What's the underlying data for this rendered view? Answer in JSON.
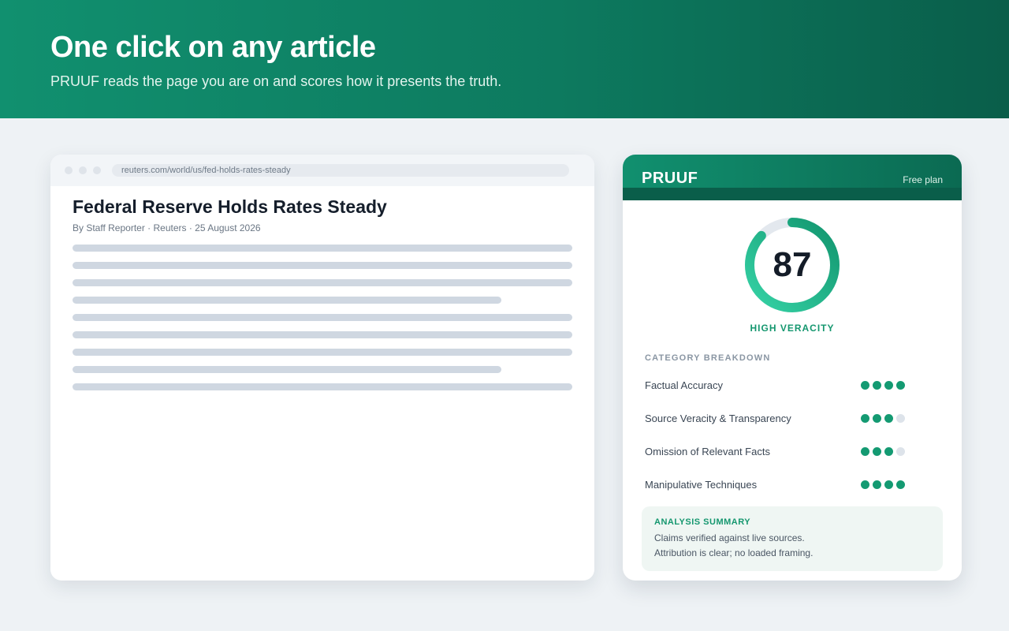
{
  "hero": {
    "title": "One click on any article",
    "subtitle": "PRUUF reads the page you are on and scores how it presents the truth."
  },
  "browser": {
    "url": "reuters.com/world/us/fed-holds-rates-steady",
    "article": {
      "headline": "Federal Reserve Holds Rates Steady",
      "byline": "By Staff Reporter · Reuters · 25 August 2026"
    }
  },
  "panel": {
    "brand": "PRUUF",
    "plan": "Free plan",
    "score": "87",
    "score_value": 87,
    "verdict": "HIGH VERACITY",
    "category_title": "CATEGORY BREAKDOWN",
    "categories": [
      {
        "label": "Factual Accuracy",
        "rating": 4,
        "max": 4
      },
      {
        "label": "Source Veracity & Transparency",
        "rating": 3,
        "max": 4
      },
      {
        "label": "Omission of Relevant Facts",
        "rating": 3,
        "max": 4
      },
      {
        "label": "Manipulative Techniques",
        "rating": 4,
        "max": 4
      }
    ],
    "summary": {
      "title": "ANALYSIS SUMMARY",
      "lines": [
        "Claims verified against live sources.",
        "Attribution is clear; no loaded framing."
      ]
    }
  },
  "colors": {
    "brand_green": "#11906f",
    "brand_dark": "#0a5e4a",
    "rating_on": "#149a72",
    "rating_off": "#dde3ea"
  }
}
